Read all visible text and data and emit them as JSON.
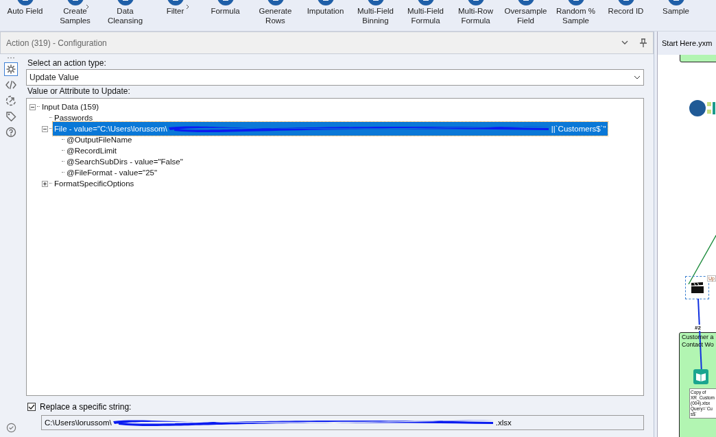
{
  "toolbar": [
    {
      "label": "Auto Field"
    },
    {
      "label": "Create\nSamples",
      "has_arrow": true
    },
    {
      "label": "Data\nCleansing"
    },
    {
      "label": "Filter",
      "has_arrow": true
    },
    {
      "label": "Formula"
    },
    {
      "label": "Generate\nRows"
    },
    {
      "label": "Imputation"
    },
    {
      "label": "Multi-Field\nBinning"
    },
    {
      "label": "Multi-Field\nFormula"
    },
    {
      "label": "Multi-Row\nFormula"
    },
    {
      "label": "Oversample\nField"
    },
    {
      "label": "Random %\nSample"
    },
    {
      "label": "Record ID"
    },
    {
      "label": "Sample"
    }
  ],
  "panel": {
    "title": "Action (319) - Configuration",
    "side_icons": [
      {
        "kind": "gear",
        "selected": true
      },
      {
        "kind": "code",
        "selected": false
      },
      {
        "kind": "connect",
        "selected": false
      },
      {
        "kind": "tag",
        "selected": false
      },
      {
        "kind": "help",
        "selected": false
      }
    ],
    "action_type_label": "Select an action type:",
    "action_type": "Update Value",
    "tree_label": "Value or Attribute to Update:",
    "tree": [
      {
        "label": "Input Data (159)",
        "kind": "branch",
        "expanded": true,
        "selected": false,
        "children": [
          {
            "label": "Passwords",
            "kind": "leaf",
            "selected": false
          },
          {
            "label": "File - value=\"C:\\Users\\lorussom\\",
            "label_end": "||`Customers$`\"",
            "kind": "branch",
            "expanded": true,
            "selected": true,
            "children": [
              {
                "label": "@OutputFileName",
                "kind": "leaf",
                "selected": false
              },
              {
                "label": "@RecordLimit",
                "kind": "leaf",
                "selected": false
              },
              {
                "label": "@SearchSubDirs - value=\"False\"",
                "kind": "leaf",
                "selected": false
              },
              {
                "label": "@FileFormat - value=\"25\"",
                "kind": "leaf",
                "selected": false
              }
            ]
          },
          {
            "label": "FormatSpecificOptions",
            "kind": "branch",
            "expanded": false,
            "selected": false
          }
        ]
      }
    ],
    "replace": {
      "label": "Replace a specific string:",
      "checked": true,
      "value": "C:\\Users\\lorussom\\",
      "value_end": ".xlsx"
    }
  },
  "canvas": {
    "tab": "Start Here.yxm",
    "tool_label": "Up",
    "container_title": "Customer a\nContact Wo",
    "connection_label": "#2",
    "annotation": "Copy of\nXR_Custom\n(004).xlsx\nQuery=`Cu\ns$`"
  }
}
